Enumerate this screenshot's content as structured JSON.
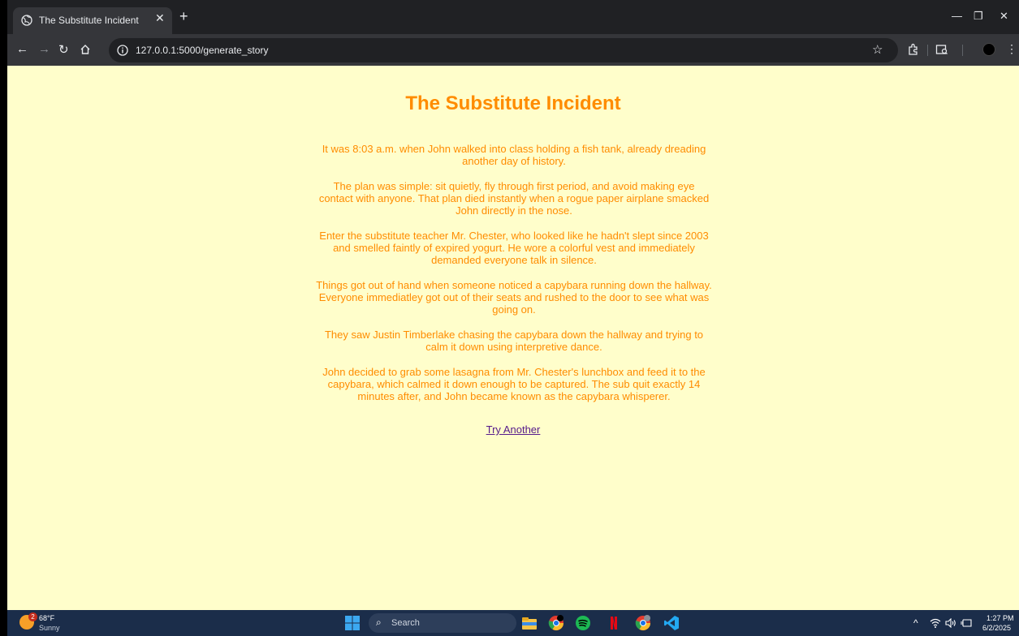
{
  "browser": {
    "tab_title": "The Substitute Incident",
    "url": "127.0.0.1:5000/generate_story"
  },
  "page": {
    "title": "The Substitute Incident",
    "paragraphs": [
      "It was 8:03 a.m. when John walked into class holding a fish tank, already dreading another day of history.",
      "The plan was simple: sit quietly, fly through first period, and avoid making eye contact with anyone. That plan died instantly when a rogue paper airplane smacked John directly in the nose.",
      "Enter the substitute teacher Mr. Chester, who looked like he hadn't slept since 2003 and smelled faintly of expired yogurt. He wore a colorful vest and immediately demanded everyone talk in silence.",
      "Things got out of hand when someone noticed a capybara running down the hallway. Everyone immediatley got out of their seats and rushed to the door to see what was going on.",
      "They saw Justin Timberlake chasing the capybara down the hallway and trying to calm it down using interpretive dance.",
      "John decided to grab some lasagna from Mr. Chester's lunchbox and feed it to the capybara, which calmed it down enough to be captured. The sub quit exactly 14 minutes after, and John became known as the capybara whisperer."
    ],
    "link_label": "Try Another",
    "title_color": "#ff8c00",
    "background_color": "#fffecb"
  },
  "taskbar": {
    "weather_badge": "2",
    "weather_temp": "68°F",
    "weather_condition": "Sunny",
    "search_label": "Search",
    "time": "1:27 PM",
    "date": "6/2/2025"
  }
}
